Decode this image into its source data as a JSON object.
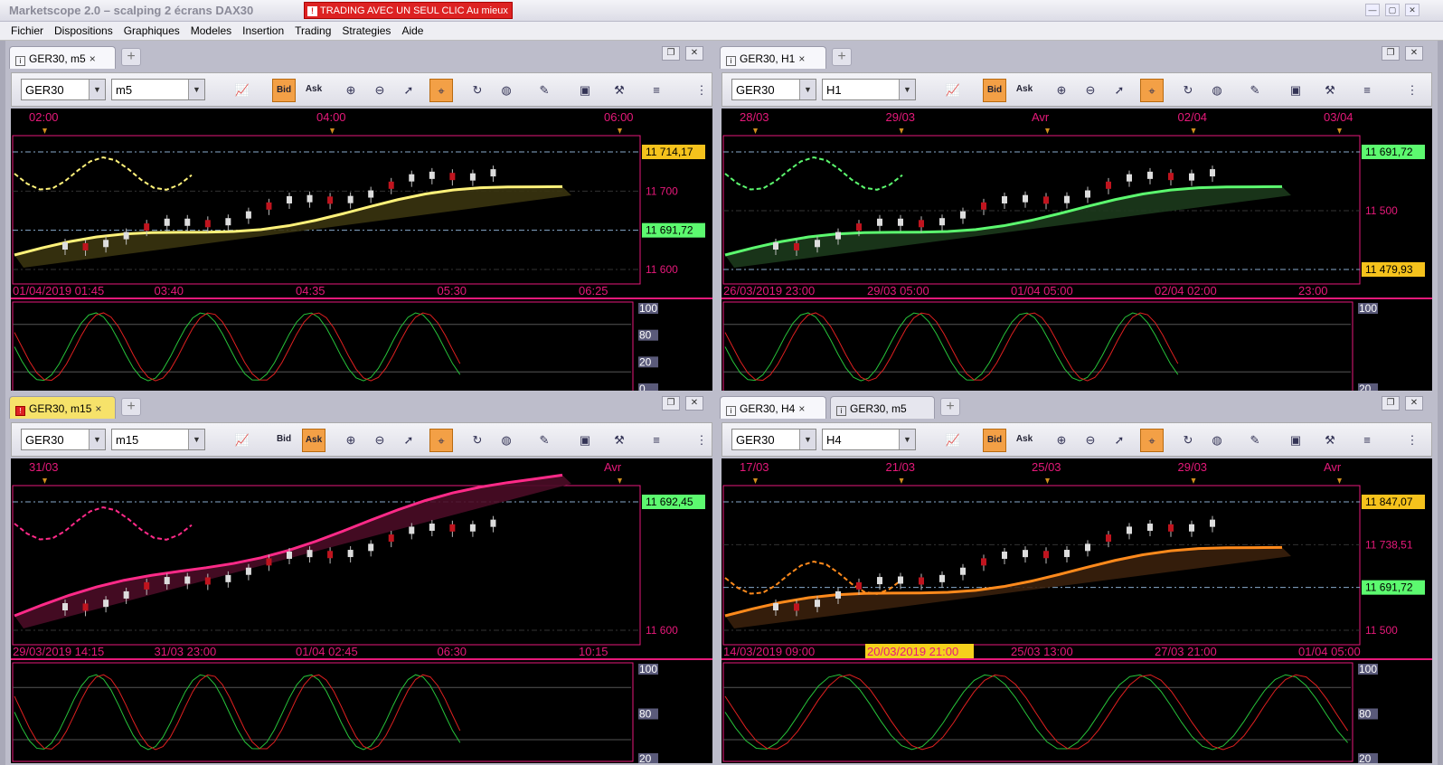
{
  "app_title": "Marketscope 2.0 – scalping 2 écrans DAX30",
  "alert_banner": "TRADING AVEC UN SEUL CLIC Au mieux",
  "menu": [
    "Fichier",
    "Dispositions",
    "Graphiques",
    "Modeles",
    "Insertion",
    "Trading",
    "Strategies",
    "Aide"
  ],
  "toolbar": {
    "bid": "Bid",
    "ask": "Ask"
  },
  "panels": [
    {
      "tabs": [
        {
          "label": "GER30, m5",
          "close": "×"
        }
      ],
      "instrument": "GER30",
      "timeframe": "m5",
      "active_price": "bid",
      "top_axis": [
        "02:00",
        "04:00",
        "06:00"
      ],
      "prices": [
        "11 714,17",
        "11 700",
        "11 691,72",
        "11 600"
      ],
      "bottom_axis": [
        "01/04/2019 01:45",
        "03:40",
        "04:35",
        "05:30",
        "06:25"
      ],
      "osc": [
        "100",
        "80",
        "20",
        "0"
      ]
    },
    {
      "tabs": [
        {
          "label": "GER30, H1",
          "close": "×"
        }
      ],
      "instrument": "GER30",
      "timeframe": "H1",
      "active_price": "bid",
      "top_axis": [
        "28/03",
        "29/03",
        "Avr",
        "02/04",
        "03/04"
      ],
      "prices": [
        "11 691,72",
        "11 500",
        "11 479,93"
      ],
      "bottom_axis": [
        "26/03/2019 23:00",
        "29/03 05:00",
        "01/04 05:00",
        "02/04 02:00",
        "23:00"
      ],
      "osc": [
        "100",
        "20"
      ]
    },
    {
      "tabs": [
        {
          "label": "GER30, m15",
          "close": "×"
        }
      ],
      "instrument": "GER30",
      "timeframe": "m15",
      "active_price": "ask",
      "top_axis": [
        "31/03",
        "Avr"
      ],
      "prices": [
        "11 692,45",
        "11 600"
      ],
      "bottom_axis": [
        "29/03/2019 14:15",
        "31/03 23:00",
        "01/04 02:45",
        "06:30",
        "10:15"
      ],
      "osc": [
        "100",
        "80",
        "20"
      ]
    },
    {
      "tabs": [
        {
          "label": "GER30, H4",
          "close": "×"
        },
        {
          "label": "GER30, m5",
          "close": ""
        }
      ],
      "instrument": "GER30",
      "timeframe": "H4",
      "active_price": "bid",
      "top_axis": [
        "17/03",
        "21/03",
        "25/03",
        "29/03",
        "Avr"
      ],
      "prices": [
        "11 847,07",
        "11 738,51",
        "11 691,72",
        "11 500"
      ],
      "bottom_axis": [
        "14/03/2019 09:00",
        "20/03/2019 21:00",
        "25/03 13:00",
        "27/03 21:00",
        "01/04 05:00"
      ],
      "osc": [
        "100",
        "80",
        "20"
      ]
    }
  ],
  "icons": [
    "chart-type-icon",
    "bid-icon",
    "ask-icon",
    "zoom-in-icon",
    "zoom-out-icon",
    "cursor-icon",
    "crosshair-icon",
    "refresh-icon",
    "globe-icon",
    "ruler-icon",
    "picture-icon",
    "tools-icon",
    "list-icon",
    "more-icon"
  ]
}
